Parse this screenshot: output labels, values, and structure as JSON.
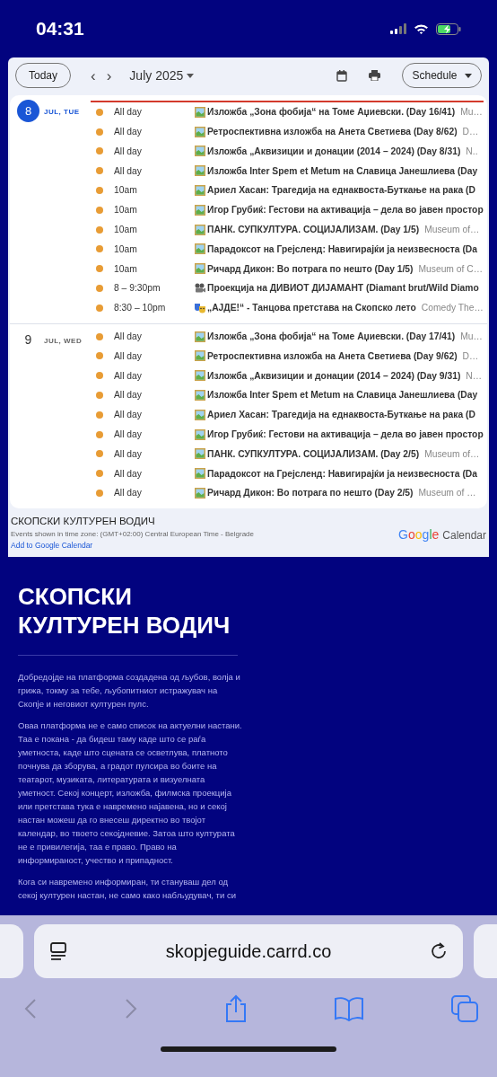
{
  "status_bar": {
    "time": "04:31"
  },
  "calendar": {
    "toolbar": {
      "today": "Today",
      "prev": "‹",
      "next": "›",
      "month": "July 2025",
      "view": "Schedule"
    },
    "days": [
      {
        "day": "8",
        "weekday": "JUL, TUE",
        "selected": true,
        "now_line": true,
        "events": [
          {
            "time": "All day",
            "kind": "picture",
            "title": "Изложба „Зона фобија“ на Томе Аџиевски. (Day 16/41)",
            "location": "Mu…"
          },
          {
            "time": "All day",
            "kind": "picture",
            "title": "Ретроспективна изложба на Анета Светиева (Day 8/62)",
            "location": "D…"
          },
          {
            "time": "All day",
            "kind": "picture",
            "title": "Изложба „Аквизиции и донации (2014 – 2024) (Day 8/31)",
            "location": "N.."
          },
          {
            "time": "All day",
            "kind": "picture",
            "title": "Изложба Inter Spem et Metum на Славица Јанешлиева (Day"
          },
          {
            "time": "10am",
            "kind": "picture",
            "title": "Ариел Хасан: Трагедија на еднаквоста-Буткање на рака (D"
          },
          {
            "time": "10am",
            "kind": "picture",
            "title": "Игор Грубиќ: Гестови на активација – дела во јавен простор"
          },
          {
            "time": "10am",
            "kind": "picture",
            "title": "ПАНК. СУПКУЛТУРА. СОЦИЈАЛИЗАМ. (Day 1/5)",
            "location": "Museum of…"
          },
          {
            "time": "10am",
            "kind": "picture",
            "title": "Парадоксот на Грејсленд: Навигирајќи ја неизвесноста (Da"
          },
          {
            "time": "10am",
            "kind": "picture",
            "title": "Ричард Дикон: Во потрага по нешто (Day 1/5)",
            "location": "Museum of C…"
          },
          {
            "time": "8 – 9:30pm",
            "kind": "projector",
            "title": "Проекција на ДИВИОТ ДИЈАМАНТ (Diamant brut/Wild Diamo"
          },
          {
            "time": "8:30 – 10pm",
            "kind": "masks",
            "title": "„АЈДЕ!“ - Танцова претстава на Скопско лето",
            "location": "Comedy The…"
          }
        ]
      },
      {
        "day": "9",
        "weekday": "JUL, WED",
        "selected": false,
        "now_line": false,
        "events": [
          {
            "time": "All day",
            "kind": "picture",
            "title": "Изложба „Зона фобија“ на Томе Аџиевски. (Day 17/41)",
            "location": "Mu…"
          },
          {
            "time": "All day",
            "kind": "picture",
            "title": "Ретроспективна изложба на Анета Светиева (Day 9/62)",
            "location": "D…"
          },
          {
            "time": "All day",
            "kind": "picture",
            "title": "Изложба „Аквизиции и донации (2014 – 2024) (Day 9/31)",
            "location": "N…"
          },
          {
            "time": "All day",
            "kind": "picture",
            "title": "Изложба Inter Spem et Metum на Славица Јанешлиева (Day"
          },
          {
            "time": "All day",
            "kind": "picture",
            "title": "Ариел Хасан: Трагедија на еднаквоста-Буткање на рака (D"
          },
          {
            "time": "All day",
            "kind": "picture",
            "title": "Игор Грубиќ: Гестови на активација – дела во јавен простор"
          },
          {
            "time": "All day",
            "kind": "picture",
            "title": "ПАНК. СУПКУЛТУРА. СОЦИЈАЛИЗАМ. (Day 2/5)",
            "location": "Museum of…"
          },
          {
            "time": "All day",
            "kind": "picture",
            "title": "Парадоксот на Грејсленд: Навигирајќи ја неизвесноста (Da"
          },
          {
            "time": "All day",
            "kind": "picture",
            "title": "Ричард Дикон: Во потрага по нешто (Day 2/5)",
            "location": "Museum of …"
          }
        ]
      }
    ],
    "footer": {
      "name": "СКОПСКИ КУЛТУРЕН ВОДИЧ",
      "timezone": "Events shown in time zone: (GMT+02:00) Central European Time - Belgrade",
      "add_link": "Add to Google Calendar",
      "brand": "Google",
      "brand_product": "Calendar"
    }
  },
  "site": {
    "heading": "СКОПСКИ КУЛТУРЕН ВОДИЧ",
    "paragraphs": [
      "Добредојде на платформа создадена од љубов, волја и грижа, токму за тебе, љубопитниот истражувач на Скопје и неговиот културен пулс.",
      "Оваа платформа не е само список на актуелни настани. Таа е покана - да бидеш таму каде што се раѓа уметноста, каде што сцената се осветлува, платното почнува да зборува, а градот пулсира во боите на театарот, музиката, литературата и визуелната уметност. Секој концерт, изложба, филмска проекција или претстава тука е навремено најавена, но и секој настан можеш да го внесеш директно во твојот календар, во твоето секојдневие. Затоа што културата не е привилегија, таа е право. Право на информираност, учество и припадност.",
      "Кога си навремено информиран, ти стануваш дел од секој културен настан, не само како набљудувач, ти си"
    ]
  },
  "browser": {
    "url": "skopjeguide.carrd.co"
  }
}
